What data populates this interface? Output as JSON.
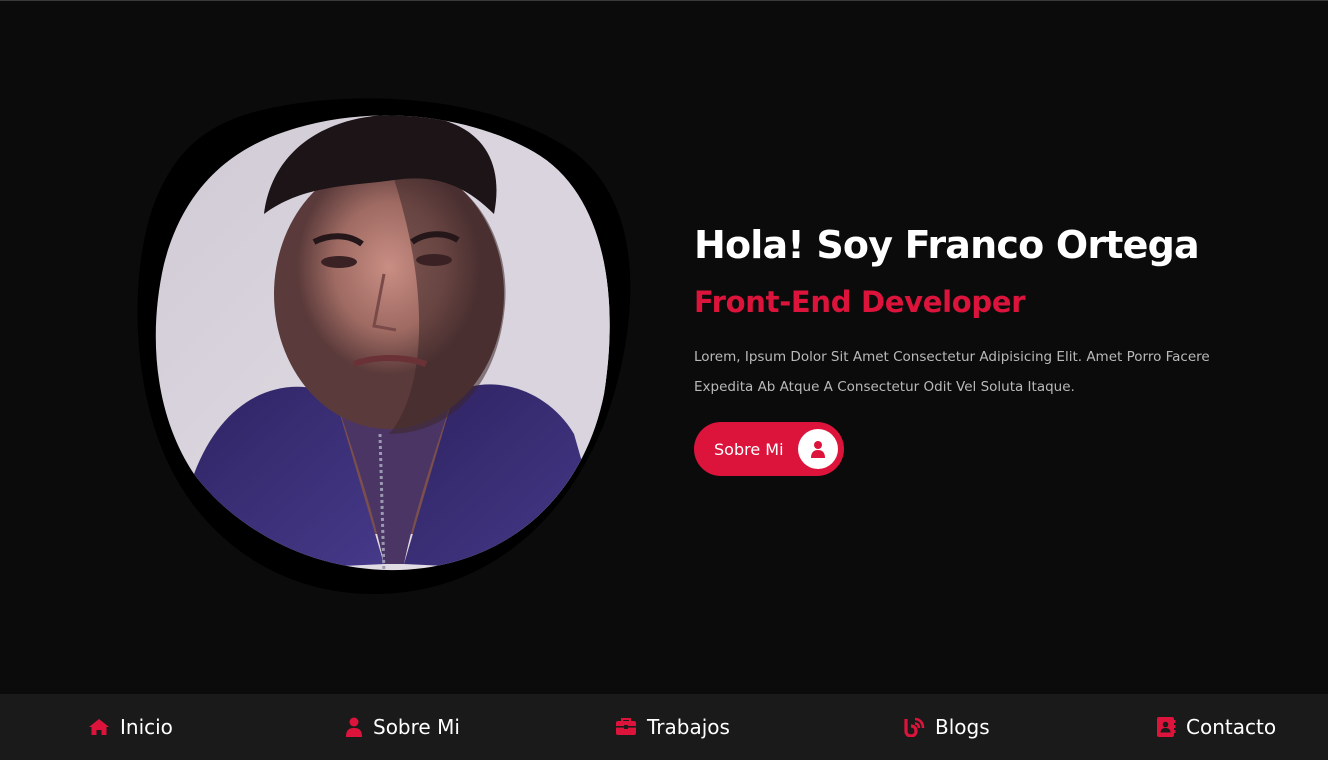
{
  "hero": {
    "title": "Hola! Soy Franco Ortega",
    "subtitle": "Front-End Developer",
    "description": "Lorem, Ipsum Dolor Sit Amet Consectetur Adipisicing Elit. Amet Porro Facere Expedita Ab Atque A Consectetur Odit Vel Soluta Itaque.",
    "button_label": "Sobre Mi",
    "button_icon": "user-icon",
    "photo": "profile-photo"
  },
  "nav": {
    "items": [
      {
        "label": "Inicio",
        "icon": "home-icon"
      },
      {
        "label": "Sobre Mi",
        "icon": "user-icon"
      },
      {
        "label": "Trabajos",
        "icon": "briefcase-icon"
      },
      {
        "label": "Blogs",
        "icon": "blog-icon"
      },
      {
        "label": "Contacto",
        "icon": "contact-book-icon"
      }
    ]
  },
  "colors": {
    "background": "#0b0b0b",
    "accent": "#dc143c",
    "nav_background": "#1a1a1a",
    "text": "#ffffff",
    "muted_text": "#b9b9b9"
  }
}
